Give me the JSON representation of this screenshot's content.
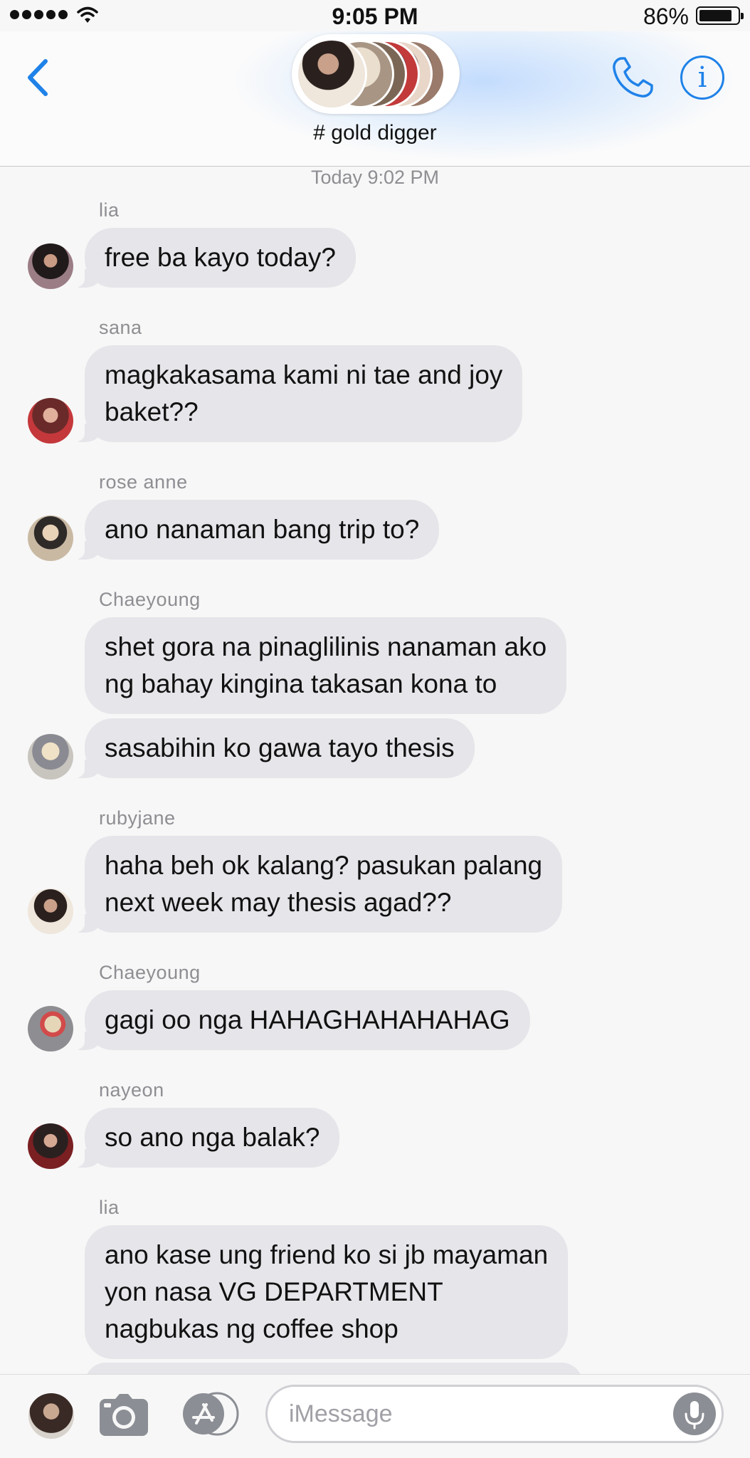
{
  "status_bar": {
    "time": "9:05 PM",
    "battery_percent": "86%",
    "battery_level": 0.86,
    "signal_bars": 5,
    "icons": [
      "signal-dots-icon",
      "wifi-icon",
      "battery-icon"
    ]
  },
  "header": {
    "group_name": "# gold digger",
    "back_icon": "chevron-left-icon",
    "call_icon": "phone-icon",
    "info_icon": "info-icon",
    "info_glyph": "i",
    "member_avatar_count": 6
  },
  "thread": {
    "timestamp": "Today 9:02 PM",
    "messages": [
      {
        "sender": "lia",
        "bubbles": [
          "free ba kayo today?"
        ]
      },
      {
        "sender": "sana",
        "bubbles": [
          "magkakasama kami ni tae and joy\nbaket??"
        ]
      },
      {
        "sender": "rose anne",
        "bubbles": [
          "ano nanaman bang trip to?"
        ]
      },
      {
        "sender": "Chaeyoung",
        "bubbles": [
          "shet gora na pinaglilinis nanaman ako\nng bahay kingina takasan kona to",
          "sasabihin ko gawa tayo thesis"
        ]
      },
      {
        "sender": "rubyjane",
        "bubbles": [
          "haha beh ok kalang? pasukan palang\nnext week may thesis agad??"
        ]
      },
      {
        "sender": "Chaeyoung",
        "bubbles": [
          "gagi oo nga HAHAGHAHAHAHAG"
        ]
      },
      {
        "sender": "nayeon",
        "bubbles": [
          "so ano nga balak?"
        ]
      },
      {
        "sender": "lia",
        "bubbles": [
          "ano kase ung friend ko si jb mayaman\nyon nasa VG DEPARTMENT\nnagbukas ng coffee shop"
        ]
      }
    ]
  },
  "composer": {
    "placeholder": "iMessage",
    "value": "",
    "icons": [
      "camera-icon",
      "app-store-icon",
      "microphone-icon"
    ]
  },
  "colors": {
    "accent": "#1f82e8",
    "bubble_received": "#e5e5ea",
    "background": "#f7f7f7",
    "meta_text": "#8e8e93"
  }
}
